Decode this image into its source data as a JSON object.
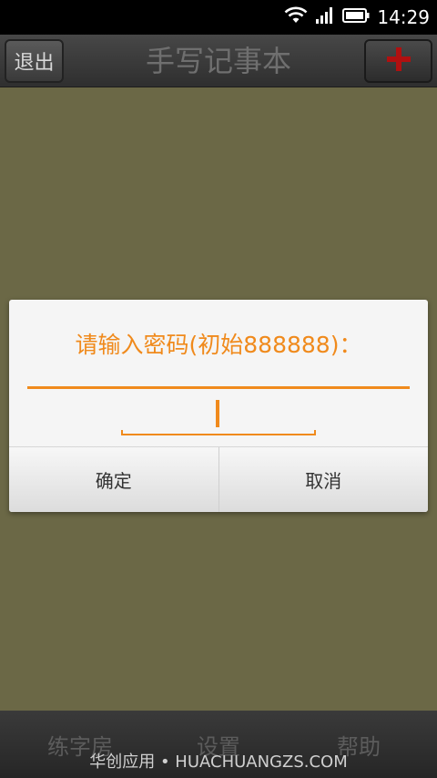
{
  "status_bar": {
    "time": "14:29",
    "icons": [
      "wifi-icon",
      "signal-icon",
      "battery-icon"
    ]
  },
  "title_bar": {
    "exit_label": "退出",
    "title": "手写记事本",
    "add_icon": "plus-icon"
  },
  "dialog": {
    "prompt": "请输入密码(初始888888)：",
    "password_value": "",
    "confirm_label": "确定",
    "cancel_label": "取消"
  },
  "bottom_nav": {
    "items": [
      {
        "label": "练字房"
      },
      {
        "label": "设置"
      },
      {
        "label": "帮助"
      }
    ]
  },
  "watermark": "华创应用 • HUACHUANGZS.COM",
  "colors": {
    "accent": "#f08a1c",
    "background": "#6b6846",
    "add_icon": "#b01010"
  }
}
